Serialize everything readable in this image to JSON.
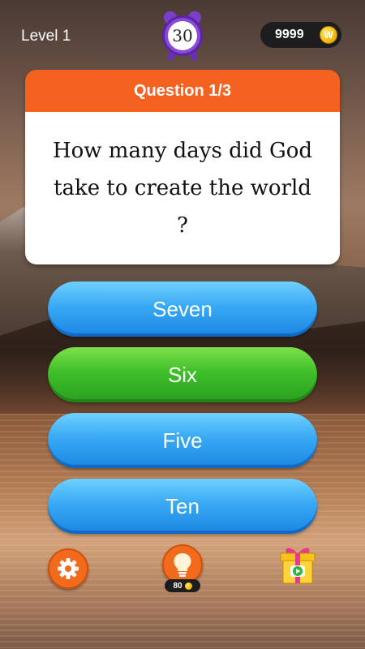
{
  "header": {
    "level_label": "Level 1",
    "timer_value": "30",
    "coins": "9999",
    "coin_icon_glyph": "W"
  },
  "question": {
    "header": "Question 1/3",
    "text": "How many days did God take to create the world ?"
  },
  "answers": [
    {
      "label": "Seven",
      "state": "default"
    },
    {
      "label": "Six",
      "state": "correct"
    },
    {
      "label": "Five",
      "state": "default"
    },
    {
      "label": "Ten",
      "state": "default"
    }
  ],
  "footer": {
    "settings_icon": "gear-icon",
    "hint_icon": "lightbulb-icon",
    "hint_cost": "80",
    "reward_icon": "gift-video-icon"
  },
  "colors": {
    "answer_blue": "#39a9f4",
    "answer_green": "#3fbf2a",
    "card_header": "#f5621f",
    "timer_purple": "#8a4ad8",
    "button_orange": "#f26a1c"
  }
}
